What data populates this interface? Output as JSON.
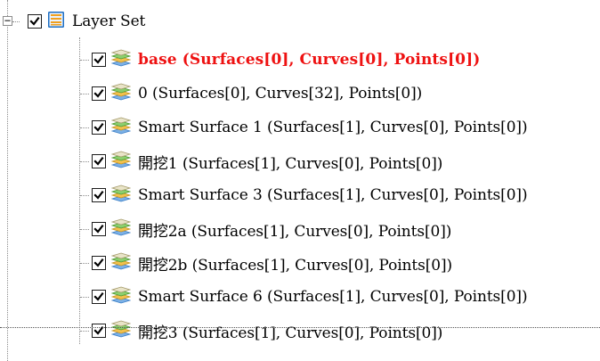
{
  "tree": {
    "root": {
      "label": "Layer Set",
      "expander": "−",
      "checked": true,
      "icon": "layer-set-icon"
    },
    "layers": [
      {
        "label": "base (Surfaces[0], Curves[0], Points[0])",
        "checked": true,
        "icon": "layer-stack-icon",
        "active": true
      },
      {
        "label": "0 (Surfaces[0], Curves[32], Points[0])",
        "checked": true,
        "icon": "layer-stack-icon",
        "active": false
      },
      {
        "label": "Smart Surface 1 (Surfaces[1], Curves[0], Points[0])",
        "checked": true,
        "icon": "layer-stack-icon",
        "active": false
      },
      {
        "label": "開挖1 (Surfaces[1], Curves[0], Points[0])",
        "checked": true,
        "icon": "layer-stack-icon",
        "active": false
      },
      {
        "label": "Smart Surface 3 (Surfaces[1], Curves[0], Points[0])",
        "checked": true,
        "icon": "layer-stack-icon",
        "active": false
      },
      {
        "label": "開挖2a (Surfaces[1], Curves[0], Points[0])",
        "checked": true,
        "icon": "layer-stack-icon",
        "active": false
      },
      {
        "label": "開挖2b (Surfaces[1], Curves[0], Points[0])",
        "checked": true,
        "icon": "layer-stack-icon",
        "active": false
      },
      {
        "label": "Smart Surface 6 (Surfaces[1], Curves[0], Points[0])",
        "checked": true,
        "icon": "layer-stack-icon",
        "active": false
      },
      {
        "label": "開挖3 (Surfaces[1], Curves[0], Points[0])",
        "checked": true,
        "icon": "layer-stack-icon",
        "active": false
      }
    ]
  },
  "colors": {
    "active_label": "#ee1111",
    "checkmark": "#000000",
    "connector": "#8c8c8c"
  }
}
